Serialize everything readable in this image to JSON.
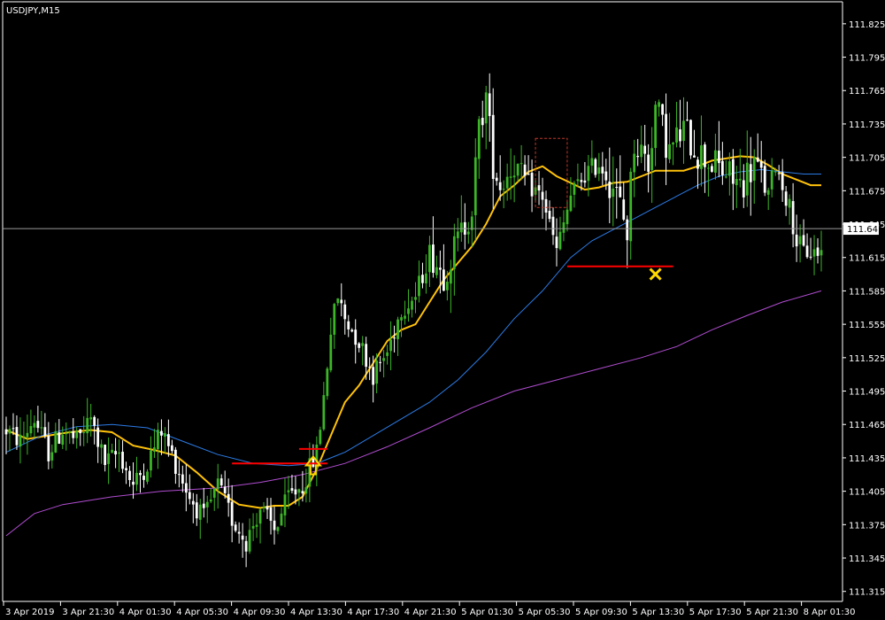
{
  "symbol_label": "USDJPY,M15",
  "colors": {
    "background": "#000000",
    "axis": "#ffffff",
    "bull_candle": "#3cb527",
    "bear_candle": "#ffffff",
    "ma_fast": "#ffc20a",
    "ma_mid": "#2c7be5",
    "ma_slow": "#b04dd0",
    "level_line": "#ff0000",
    "buy_arrow": "#ffd700",
    "exit_mark": "#ffd700",
    "pattern_box": "#c0392b",
    "price_line": "#9a9a9a"
  },
  "chart_data": {
    "type": "candlestick",
    "timeframe": "M15",
    "ylim": [
      111.31,
      111.84
    ],
    "yticks": [
      "111.825",
      "111.795",
      "111.765",
      "111.735",
      "111.705",
      "111.675",
      "111.645",
      "111.615",
      "111.585",
      "111.555",
      "111.525",
      "111.495",
      "111.465",
      "111.435",
      "111.405",
      "111.375",
      "111.345",
      "111.315"
    ],
    "xticks": [
      "3 Apr 2019",
      "3 Apr 21:30",
      "4 Apr 01:30",
      "4 Apr 05:30",
      "4 Apr 09:30",
      "4 Apr 13:30",
      "4 Apr 17:30",
      "4 Apr 21:30",
      "5 Apr 01:30",
      "5 Apr 05:30",
      "5 Apr 09:30",
      "5 Apr 13:30",
      "5 Apr 17:30",
      "5 Apr 21:30",
      "8 Apr 01:30"
    ],
    "current_price": "111.641",
    "close_path": [
      [
        0,
        111.46
      ],
      [
        4,
        111.45
      ],
      [
        8,
        111.47
      ],
      [
        12,
        111.44
      ],
      [
        16,
        111.46
      ],
      [
        20,
        111.45
      ],
      [
        24,
        111.47
      ],
      [
        28,
        111.43
      ],
      [
        32,
        111.44
      ],
      [
        36,
        111.41
      ],
      [
        40,
        111.43
      ],
      [
        44,
        111.46
      ],
      [
        48,
        111.43
      ],
      [
        52,
        111.4
      ],
      [
        56,
        111.38
      ],
      [
        60,
        111.41
      ],
      [
        64,
        111.38
      ],
      [
        68,
        111.36
      ],
      [
        72,
        111.39
      ],
      [
        76,
        111.37
      ],
      [
        80,
        111.4
      ],
      [
        84,
        111.41
      ],
      [
        88,
        111.44
      ],
      [
        90,
        111.49
      ],
      [
        92,
        111.55
      ],
      [
        94,
        111.58
      ],
      [
        96,
        111.56
      ],
      [
        100,
        111.54
      ],
      [
        104,
        111.51
      ],
      [
        108,
        111.53
      ],
      [
        112,
        111.57
      ],
      [
        116,
        111.58
      ],
      [
        120,
        111.62
      ],
      [
        124,
        111.6
      ],
      [
        128,
        111.63
      ],
      [
        132,
        111.66
      ],
      [
        134,
        111.73
      ],
      [
        136,
        111.76
      ],
      [
        138,
        111.7
      ],
      [
        140,
        111.68
      ],
      [
        144,
        111.7
      ],
      [
        148,
        111.68
      ],
      [
        152,
        111.67
      ],
      [
        156,
        111.62
      ],
      [
        160,
        111.67
      ],
      [
        164,
        111.69
      ],
      [
        168,
        111.7
      ],
      [
        172,
        111.68
      ],
      [
        176,
        111.64
      ],
      [
        178,
        111.72
      ],
      [
        182,
        111.7
      ],
      [
        184,
        111.75
      ],
      [
        188,
        111.71
      ],
      [
        192,
        111.73
      ],
      [
        196,
        111.71
      ],
      [
        200,
        111.7
      ],
      [
        204,
        111.69
      ],
      [
        208,
        111.68
      ],
      [
        212,
        111.7
      ],
      [
        216,
        111.67
      ],
      [
        218,
        111.7
      ],
      [
        220,
        111.68
      ],
      [
        222,
        111.66
      ],
      [
        224,
        111.63
      ],
      [
        226,
        111.62
      ]
    ],
    "total_bars": 232,
    "series": [
      {
        "name": "",
        "role": "fast_ma",
        "points": [
          [
            0,
            111.46
          ],
          [
            6,
            111.452
          ],
          [
            12,
            111.455
          ],
          [
            18,
            111.458
          ],
          [
            24,
            111.46
          ],
          [
            30,
            111.458
          ],
          [
            36,
            111.446
          ],
          [
            42,
            111.442
          ],
          [
            48,
            111.437
          ],
          [
            54,
            111.422
          ],
          [
            60,
            111.405
          ],
          [
            66,
            111.393
          ],
          [
            72,
            111.39
          ],
          [
            76,
            111.392
          ],
          [
            80,
            111.392
          ],
          [
            84,
            111.4
          ],
          [
            88,
            111.425
          ],
          [
            92,
            111.455
          ],
          [
            96,
            111.485
          ],
          [
            100,
            111.5
          ],
          [
            104,
            111.52
          ],
          [
            108,
            111.54
          ],
          [
            112,
            111.55
          ],
          [
            116,
            111.555
          ],
          [
            120,
            111.575
          ],
          [
            124,
            111.595
          ],
          [
            128,
            111.61
          ],
          [
            132,
            111.625
          ],
          [
            136,
            111.645
          ],
          [
            140,
            111.67
          ],
          [
            144,
            111.68
          ],
          [
            148,
            111.692
          ],
          [
            152,
            111.697
          ],
          [
            156,
            111.688
          ],
          [
            160,
            111.682
          ],
          [
            164,
            111.676
          ],
          [
            168,
            111.678
          ],
          [
            172,
            111.682
          ],
          [
            176,
            111.683
          ],
          [
            180,
            111.688
          ],
          [
            184,
            111.693
          ],
          [
            188,
            111.693
          ],
          [
            192,
            111.693
          ],
          [
            196,
            111.697
          ],
          [
            200,
            111.702
          ],
          [
            204,
            111.704
          ],
          [
            208,
            111.706
          ],
          [
            212,
            111.705
          ],
          [
            216,
            111.698
          ],
          [
            220,
            111.69
          ],
          [
            224,
            111.685
          ],
          [
            228,
            111.68
          ],
          [
            231,
            111.68
          ]
        ]
      },
      {
        "name": "",
        "role": "mid_ma",
        "points": [
          [
            0,
            111.44
          ],
          [
            10,
            111.455
          ],
          [
            20,
            111.463
          ],
          [
            30,
            111.465
          ],
          [
            40,
            111.462
          ],
          [
            50,
            111.45
          ],
          [
            60,
            111.438
          ],
          [
            70,
            111.43
          ],
          [
            80,
            111.428
          ],
          [
            88,
            111.43
          ],
          [
            96,
            111.44
          ],
          [
            104,
            111.455
          ],
          [
            112,
            111.47
          ],
          [
            120,
            111.485
          ],
          [
            128,
            111.505
          ],
          [
            136,
            111.53
          ],
          [
            144,
            111.56
          ],
          [
            152,
            111.585
          ],
          [
            160,
            111.615
          ],
          [
            166,
            111.63
          ],
          [
            172,
            111.64
          ],
          [
            178,
            111.65
          ],
          [
            184,
            111.66
          ],
          [
            190,
            111.67
          ],
          [
            196,
            111.68
          ],
          [
            202,
            111.688
          ],
          [
            208,
            111.692
          ],
          [
            214,
            111.694
          ],
          [
            220,
            111.692
          ],
          [
            226,
            111.69
          ],
          [
            231,
            111.69
          ]
        ]
      },
      {
        "name": "",
        "role": "slow_ma",
        "points": [
          [
            0,
            111.365
          ],
          [
            8,
            111.385
          ],
          [
            16,
            111.393
          ],
          [
            30,
            111.4
          ],
          [
            44,
            111.405
          ],
          [
            60,
            111.408
          ],
          [
            72,
            111.413
          ],
          [
            84,
            111.42
          ],
          [
            96,
            111.43
          ],
          [
            108,
            111.445
          ],
          [
            120,
            111.462
          ],
          [
            132,
            111.48
          ],
          [
            144,
            111.495
          ],
          [
            156,
            111.505
          ],
          [
            168,
            111.515
          ],
          [
            180,
            111.525
          ],
          [
            190,
            111.535
          ],
          [
            200,
            111.55
          ],
          [
            210,
            111.563
          ],
          [
            220,
            111.575
          ],
          [
            231,
            111.585
          ]
        ]
      }
    ],
    "annotations": [
      {
        "kind": "level",
        "from_bar": 64,
        "to_bar": 91,
        "price": 111.43
      },
      {
        "kind": "level",
        "from_bar": 83,
        "to_bar": 91,
        "price": 111.443
      },
      {
        "kind": "buy_arrow",
        "bar": 87,
        "price": 111.425
      },
      {
        "kind": "level",
        "from_bar": 159,
        "to_bar": 189,
        "price": 111.607
      },
      {
        "kind": "exit_mark",
        "bar": 184,
        "price": 111.6
      },
      {
        "kind": "box",
        "from_bar": 150,
        "to_bar": 159,
        "price_low": 111.66,
        "price_high": 111.722
      }
    ]
  }
}
